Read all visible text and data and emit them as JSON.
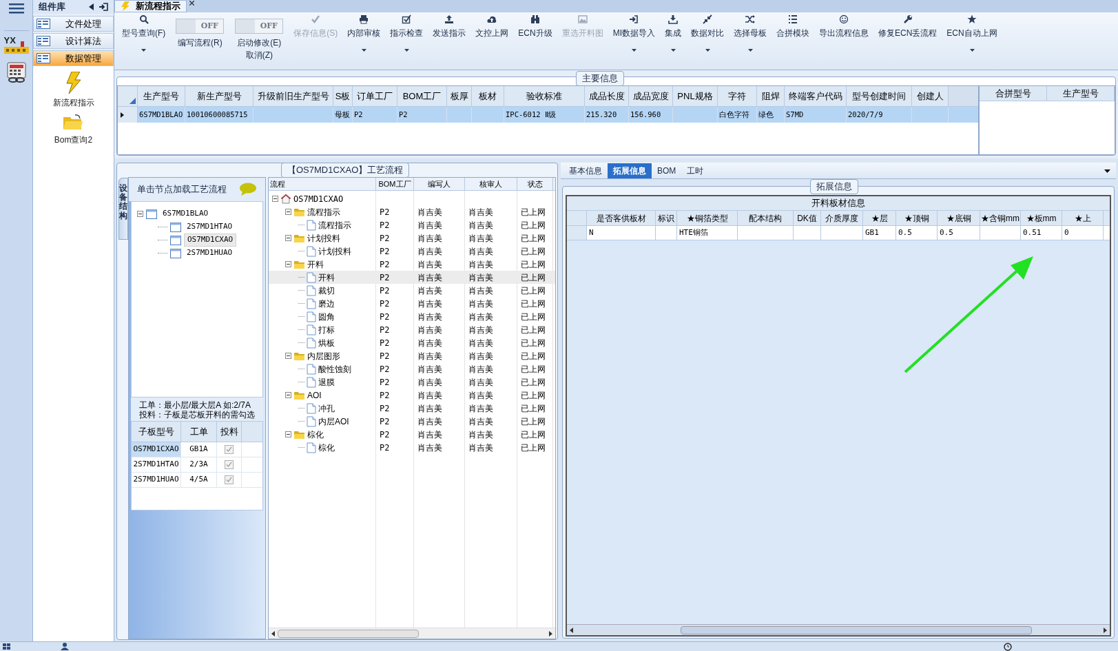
{
  "rail": {
    "logo_text": "YX"
  },
  "sidebar": {
    "title": "组件库",
    "items": [
      {
        "label": "文件处理",
        "selected": false
      },
      {
        "label": "设计算法",
        "selected": false
      },
      {
        "label": "数据管理",
        "selected": true
      }
    ],
    "tools": [
      {
        "label": "新流程指示",
        "kind": "lightning"
      },
      {
        "label": "Bom查询2",
        "kind": "folder"
      }
    ]
  },
  "tabs": [
    {
      "label": "新流程指示",
      "selected": true
    }
  ],
  "toolbar": [
    {
      "kind": "button",
      "label": "型号查询(F)",
      "disabled": false,
      "dropdown": true
    },
    {
      "kind": "toggle",
      "switch_text": "OFF",
      "on": false,
      "label": "编写流程(R)"
    },
    {
      "kind": "toggle",
      "switch_text": "OFF",
      "on": false,
      "label": "启动修改(E)",
      "sub_label": "取消(Z)"
    },
    {
      "kind": "button",
      "label": "保存信息(S)",
      "disabled": true,
      "dropdown": false
    },
    {
      "kind": "button",
      "label": "内部审核",
      "disabled": false,
      "dropdown": true
    },
    {
      "kind": "button",
      "label": "指示检查",
      "disabled": false,
      "dropdown": true
    },
    {
      "kind": "button",
      "label": "发送指示",
      "disabled": false,
      "dropdown": false
    },
    {
      "kind": "button",
      "label": "文控上网",
      "disabled": false,
      "dropdown": false
    },
    {
      "kind": "button",
      "label": "ECN升级",
      "disabled": false,
      "dropdown": false
    },
    {
      "kind": "button",
      "label": "重选开料图",
      "disabled": true,
      "dropdown": false
    },
    {
      "kind": "button",
      "label": "MI数据导入",
      "disabled": false,
      "dropdown": true
    },
    {
      "kind": "button",
      "label": "集成",
      "disabled": false,
      "dropdown": true
    },
    {
      "kind": "button",
      "label": "数据对比",
      "disabled": false,
      "dropdown": true
    },
    {
      "kind": "button",
      "label": "选择母板",
      "disabled": false,
      "dropdown": true
    },
    {
      "kind": "button",
      "label": "合拼模块",
      "disabled": false,
      "dropdown": false
    },
    {
      "kind": "button",
      "label": "导出流程信息",
      "disabled": false,
      "dropdown": false
    },
    {
      "kind": "button",
      "label": "修复ECN丢流程",
      "disabled": false,
      "dropdown": false
    },
    {
      "kind": "button",
      "label": "ECN自动上网",
      "disabled": false,
      "dropdown": true
    }
  ],
  "main_info": {
    "title": "主要信息",
    "columns": [
      "生产型号",
      "新生产型号",
      "升级前旧生产型号",
      "S板",
      "订单工厂",
      "BOM工厂",
      "板厚",
      "板材",
      "验收标准",
      "成品长度",
      "成品宽度",
      "PNL规格",
      "字符",
      "阻焊",
      "终端客户代码",
      "型号创建时间",
      "创建人"
    ],
    "rows": [
      {
        "selected": true,
        "cells": [
          "6S7MD1BLAO",
          "10010600085715",
          "",
          "母板",
          "P2",
          "P2",
          "",
          "",
          "IPC-6012 Ⅱ级",
          "215.320",
          "156.960",
          "",
          "白色字符",
          "绿色",
          "S7MD",
          "2020/7/9",
          ""
        ]
      }
    ],
    "merge_columns": [
      "合拼型号",
      "生产型号"
    ]
  },
  "structure": {
    "tab": "设备结构",
    "header": "单击节点加载工艺流程",
    "tree": [
      {
        "label": "6S7MD1BLAO",
        "expanded": true,
        "selected": false,
        "children": [
          {
            "label": "2S7MD1HTAO",
            "selected": false
          },
          {
            "label": "OS7MD1CXAO",
            "selected": true
          },
          {
            "label": "2S7MD1HUAO",
            "selected": false
          }
        ]
      }
    ],
    "note": [
      "工单：最小层/最大层A 如:2/7A",
      "投料：子板是芯板开料的需勾选"
    ],
    "columns": [
      "子板型号",
      "工单",
      "投料"
    ],
    "rows": [
      {
        "cells": [
          "OS7MD1CXAO",
          "GB1A"
        ],
        "checked": true,
        "selected": true
      },
      {
        "cells": [
          "2S7MD1HTAO",
          "2/3A"
        ],
        "checked": true,
        "selected": false
      },
      {
        "cells": [
          "2S7MD1HUAO",
          "4/5A"
        ],
        "checked": true,
        "selected": false
      }
    ]
  },
  "flow": {
    "title": "【OS7MD1CXAO】工艺流程",
    "columns": [
      "流程",
      "BOM工厂",
      "编写人",
      "核审人",
      "状态"
    ],
    "tree": [
      {
        "kind": "root",
        "label": "OS7MD1CXAO",
        "expanded": true,
        "selected": false,
        "children": [
          {
            "kind": "folder",
            "label": "流程指示",
            "expanded": true,
            "selected": false,
            "bom": "P2",
            "writer": "肖吉美",
            "reviewer": "肖吉美",
            "status": "已上网",
            "children": [
              {
                "kind": "step",
                "label": "流程指示",
                "selected": false,
                "bom": "P2",
                "writer": "肖吉美",
                "reviewer": "肖吉美",
                "status": "已上网"
              }
            ]
          },
          {
            "kind": "folder",
            "label": "计划投料",
            "expanded": true,
            "selected": false,
            "bom": "P2",
            "writer": "肖吉美",
            "reviewer": "肖吉美",
            "status": "已上网",
            "children": [
              {
                "kind": "step",
                "label": "计划投料",
                "selected": false,
                "bom": "P2",
                "writer": "肖吉美",
                "reviewer": "肖吉美",
                "status": "已上网"
              }
            ]
          },
          {
            "kind": "folder",
            "label": "开料",
            "expanded": true,
            "selected": false,
            "bom": "P2",
            "writer": "肖吉美",
            "reviewer": "肖吉美",
            "status": "已上网",
            "children": [
              {
                "kind": "step",
                "label": "开料",
                "selected": true,
                "bom": "P2",
                "writer": "肖吉美",
                "reviewer": "肖吉美",
                "status": "已上网"
              },
              {
                "kind": "step",
                "label": "裁切",
                "selected": false,
                "bom": "P2",
                "writer": "肖吉美",
                "reviewer": "肖吉美",
                "status": "已上网"
              },
              {
                "kind": "step",
                "label": "磨边",
                "selected": false,
                "bom": "P2",
                "writer": "肖吉美",
                "reviewer": "肖吉美",
                "status": "已上网"
              },
              {
                "kind": "step",
                "label": "圆角",
                "selected": false,
                "bom": "P2",
                "writer": "肖吉美",
                "reviewer": "肖吉美",
                "status": "已上网"
              },
              {
                "kind": "step",
                "label": "打标",
                "selected": false,
                "bom": "P2",
                "writer": "肖吉美",
                "reviewer": "肖吉美",
                "status": "已上网"
              },
              {
                "kind": "step",
                "label": "烘板",
                "selected": false,
                "bom": "P2",
                "writer": "肖吉美",
                "reviewer": "肖吉美",
                "status": "已上网"
              }
            ]
          },
          {
            "kind": "folder",
            "label": "内层图形",
            "expanded": true,
            "selected": false,
            "bom": "P2",
            "writer": "肖吉美",
            "reviewer": "肖吉美",
            "status": "已上网",
            "children": [
              {
                "kind": "step",
                "label": "酸性蚀刻",
                "selected": false,
                "bom": "P2",
                "writer": "肖吉美",
                "reviewer": "肖吉美",
                "status": "已上网"
              },
              {
                "kind": "step",
                "label": "退膜",
                "selected": false,
                "bom": "P2",
                "writer": "肖吉美",
                "reviewer": "肖吉美",
                "status": "已上网"
              }
            ]
          },
          {
            "kind": "folder",
            "label": "AOI",
            "expanded": true,
            "selected": false,
            "bom": "P2",
            "writer": "肖吉美",
            "reviewer": "肖吉美",
            "status": "已上网",
            "children": [
              {
                "kind": "step",
                "label": "冲孔",
                "selected": false,
                "bom": "P2",
                "writer": "肖吉美",
                "reviewer": "肖吉美",
                "status": "已上网"
              },
              {
                "kind": "step",
                "label": "内层AOI",
                "selected": false,
                "bom": "P2",
                "writer": "肖吉美",
                "reviewer": "肖吉美",
                "status": "已上网"
              }
            ]
          },
          {
            "kind": "folder",
            "label": "棕化",
            "expanded": true,
            "selected": false,
            "bom": "P2",
            "writer": "肖吉美",
            "reviewer": "肖吉美",
            "status": "已上网",
            "children": [
              {
                "kind": "step",
                "label": "棕化",
                "selected": false,
                "bom": "P2",
                "writer": "肖吉美",
                "reviewer": "肖吉美",
                "status": "已上网"
              }
            ]
          }
        ]
      }
    ]
  },
  "detail": {
    "tabs": [
      {
        "label": "基本信息",
        "selected": false
      },
      {
        "label": "拓展信息",
        "selected": true
      },
      {
        "label": "BOM",
        "selected": false
      },
      {
        "label": "工时",
        "selected": false
      }
    ],
    "group_title": "拓展信息",
    "table_title": "开料板材信息",
    "columns": [
      "是否客供板材",
      "标识",
      "★铜箔类型",
      "配本结构",
      "DK值",
      "介质厚度",
      "★层",
      "★顶铜",
      "★底铜",
      "★含铜mm",
      "★板mm",
      "★上"
    ],
    "rows": [
      {
        "cells": [
          "N",
          "",
          "HTE铜箔",
          "",
          "",
          "",
          "GB1",
          "0.5",
          "0.5",
          "",
          "0.51",
          "0"
        ]
      }
    ]
  },
  "annotation": {
    "kind": "arrow"
  }
}
